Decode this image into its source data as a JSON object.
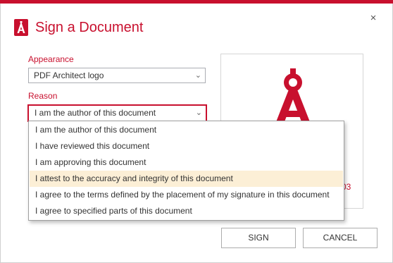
{
  "dialog": {
    "title": "Sign a Document",
    "close_glyph": "×",
    "logo_icon": "pdf-architect-logo-icon",
    "accent_color": "#c8102e"
  },
  "appearance": {
    "label": "Appearance",
    "selected": "PDF Architect logo"
  },
  "reason": {
    "label": "Reason",
    "selected": "I am the author of this document",
    "options": [
      "I am the author of this document",
      "I have reviewed this document",
      "I am approving this document",
      "I attest to the accuracy and integrity of this document",
      "I agree to the terms defined by the placement of my signature in this document",
      "I agree to specified parts of this document"
    ],
    "highlighted_index": 3
  },
  "preview": {
    "partial_text": "03"
  },
  "buttons": {
    "sign": "SIGN",
    "cancel": "CANCEL"
  }
}
